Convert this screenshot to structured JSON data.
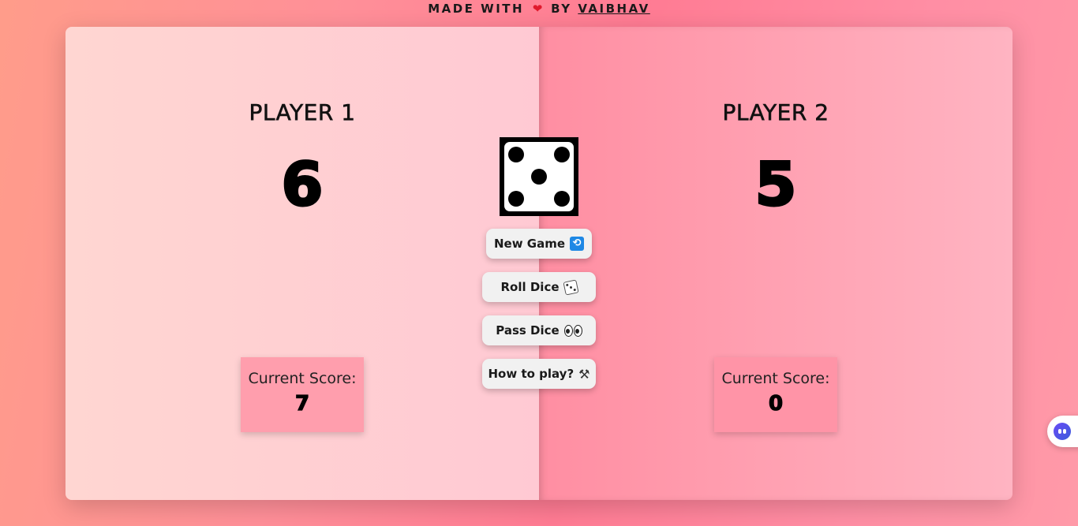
{
  "header": {
    "made_with": "MADE WITH",
    "heart_icon": "heart-icon",
    "by": "BY",
    "author": "VAIBHAV"
  },
  "players": [
    {
      "name": "PLAYER 1",
      "score": "6",
      "current_label": "Current Score:",
      "current_value": "7"
    },
    {
      "name": "PLAYER 2",
      "score": "5",
      "current_label": "Current Score:",
      "current_value": "0"
    }
  ],
  "dice": {
    "face_value": 5,
    "icon": "dice-five-icon"
  },
  "buttons": {
    "new_game": "New Game",
    "new_game_icon": "repeat-icon",
    "roll_dice": "Roll Dice",
    "roll_dice_icon": "dice-icon",
    "pass_dice": "Pass Dice",
    "pass_dice_icon": "eyes-icon",
    "how_to_play": "How to play?",
    "how_to_play_icon": "tools-icon"
  },
  "colors": {
    "player1_bg": "#ffd6d2",
    "player2_bg": "#ff8ea2",
    "current_box": "#ff9ead",
    "button_bg": "#f1f1f1",
    "heart": "#e0192c"
  },
  "side_widget": {
    "icon": "assistant-face-icon"
  }
}
